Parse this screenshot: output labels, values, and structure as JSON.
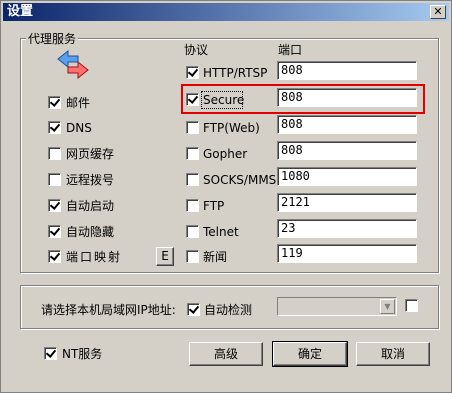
{
  "window": {
    "title": "设置",
    "close_glyph": "✕"
  },
  "proxy_group": {
    "legend": "代理服务",
    "services": [
      {
        "label": "邮件",
        "checked": true
      },
      {
        "label": "DNS",
        "checked": true
      },
      {
        "label": "网页缓存",
        "checked": false
      },
      {
        "label": "远程拨号",
        "checked": false
      },
      {
        "label": "自动启动",
        "checked": true
      },
      {
        "label": "自动隐藏",
        "checked": true
      },
      {
        "label": "端口映射",
        "checked": true
      }
    ],
    "port_map_button": "E",
    "protocol_header": "协议",
    "port_header": "端口",
    "protocols": [
      {
        "label": "HTTP/RTSP",
        "checked": true,
        "port": "808"
      },
      {
        "label": "Secure",
        "checked": true,
        "port": "808"
      },
      {
        "label": "FTP(Web)",
        "checked": false,
        "port": "808"
      },
      {
        "label": "Gopher",
        "checked": false,
        "port": "808"
      },
      {
        "label": "SOCKS/MMS",
        "checked": false,
        "port": "1080"
      },
      {
        "label": "FTP",
        "checked": false,
        "port": "2121"
      },
      {
        "label": "Telnet",
        "checked": false,
        "port": "23"
      },
      {
        "label": "新闻",
        "checked": false,
        "port": "119"
      }
    ]
  },
  "lan_group": {
    "label": "请选择本机局域网IP地址:",
    "auto_detect_label": "自动检测",
    "auto_detect_checked": true,
    "ip_value": "",
    "extra_checked": false
  },
  "footer": {
    "nt_service_label": "NT服务",
    "nt_service_checked": true,
    "advanced_button": "高级",
    "ok_button": "确定",
    "cancel_button": "取消"
  },
  "colors": {
    "title_start": "#0a246a",
    "title_end": "#a6caf0",
    "highlight": "#e00000",
    "face": "#d4d0c8"
  },
  "icons": {
    "proxy": "proxy-arrows-icon",
    "close": "close-icon",
    "dropdown": "chevron-down-icon"
  }
}
